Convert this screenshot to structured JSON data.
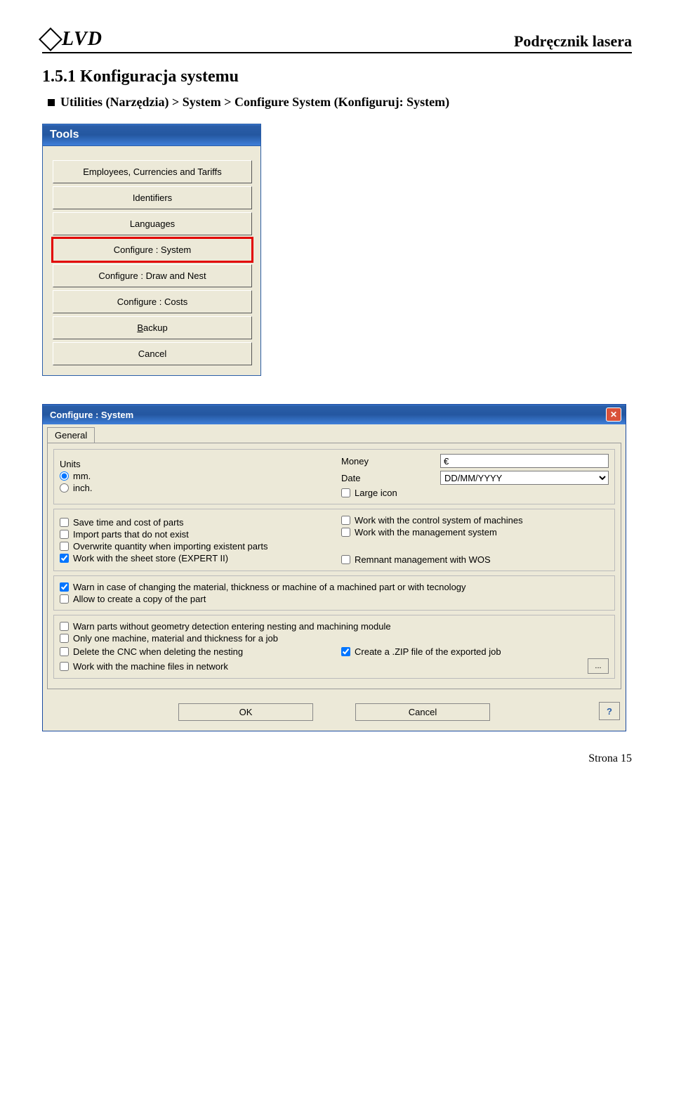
{
  "header": {
    "logo_text": "LVD",
    "doc_title": "Podręcznik lasera"
  },
  "section": {
    "title": "1.5.1 Konfiguracja systemu",
    "instruction": "Utilities (Narzędzia) > System > Configure System (Konfiguruj: System)"
  },
  "tools_window": {
    "title": "Tools",
    "items": [
      "Employees, Currencies and Tariffs",
      "Identifiers",
      "Languages",
      "Configure : System",
      "Configure : Draw and Nest",
      "Configure : Costs",
      "Backup",
      "Cancel"
    ],
    "highlight_index": 3,
    "backup_underline_char": "B"
  },
  "config_window": {
    "title": "Configure : System",
    "tab": "General",
    "units_label": "Units",
    "unit_mm": "mm.",
    "unit_inch": "inch.",
    "unit_selected": "mm",
    "money_label": "Money",
    "money_value": "€",
    "date_label": "Date",
    "date_value": "DD/MM/YYYY",
    "large_icon": "Large icon",
    "checks1_left": [
      {
        "label": "Save time and cost of parts",
        "checked": false
      },
      {
        "label": "Import parts that do not exist",
        "checked": false
      },
      {
        "label": "Overwrite quantity when importing existent parts",
        "checked": false
      },
      {
        "label": "Work with the sheet store (EXPERT II)",
        "checked": true
      }
    ],
    "checks1_right": [
      {
        "label": "Work with the control system of machines",
        "checked": false
      },
      {
        "label": "Work with the management system",
        "checked": false
      },
      {
        "label": "",
        "checked": false,
        "hidden": true
      },
      {
        "label": "Remnant management with WOS",
        "checked": false
      }
    ],
    "checks2": [
      {
        "label": "Warn in case of changing the material, thickness or machine of a machined part or with tecnology",
        "checked": true
      },
      {
        "label": "Allow to create a copy of the part",
        "checked": false
      }
    ],
    "checks3_left": [
      {
        "label": "Warn parts without geometry detection entering nesting and machining module",
        "checked": false
      },
      {
        "label": "Only one machine, material and thickness for a job",
        "checked": false
      },
      {
        "label": "Delete the CNC when deleting the nesting",
        "checked": false
      },
      {
        "label": "Work with the machine files in network",
        "checked": false
      }
    ],
    "checks3_right_zip": {
      "label": "Create a .ZIP file of the exported job",
      "checked": true
    },
    "ellipsis": "...",
    "ok": "OK",
    "cancel": "Cancel",
    "help": "?"
  },
  "footer": "Strona 15"
}
